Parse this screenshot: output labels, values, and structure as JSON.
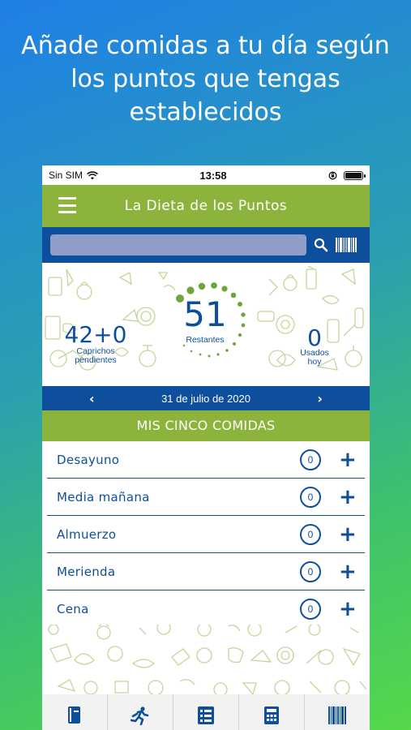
{
  "promo": {
    "line1": "Añade comidas a tu día según",
    "line2": "los puntos que tengas",
    "line3": "establecidos"
  },
  "status_bar": {
    "carrier": "Sin SIM",
    "time": "13:58"
  },
  "app": {
    "title": "La Dieta de los Puntos"
  },
  "search": {
    "placeholder": ""
  },
  "summary": {
    "caprichos_value": "42+0",
    "caprichos_label_1": "Caprichos",
    "caprichos_label_2": "pendientes",
    "remaining_value": "51",
    "remaining_label": "Restantes",
    "used_value": "0",
    "used_label_1": "Usados",
    "used_label_2": "hoy"
  },
  "date_nav": {
    "date": "31 de julio de 2020"
  },
  "meals": {
    "header": "MIS CINCO COMIDAS",
    "items": [
      {
        "name": "Desayuno",
        "count": "0"
      },
      {
        "name": "Media mañana",
        "count": "0"
      },
      {
        "name": "Almuerzo",
        "count": "0"
      },
      {
        "name": "Merienda",
        "count": "0"
      },
      {
        "name": "Cena",
        "count": "0"
      }
    ],
    "add_symbol": "+"
  },
  "tabbar": {
    "tabs": [
      "book-icon",
      "running-icon",
      "list-icon",
      "calculator-icon",
      "barcode-icon"
    ]
  },
  "colors": {
    "green": "#8cb43c",
    "blue": "#0d4f9c",
    "pattern": "#b8cf8a"
  }
}
